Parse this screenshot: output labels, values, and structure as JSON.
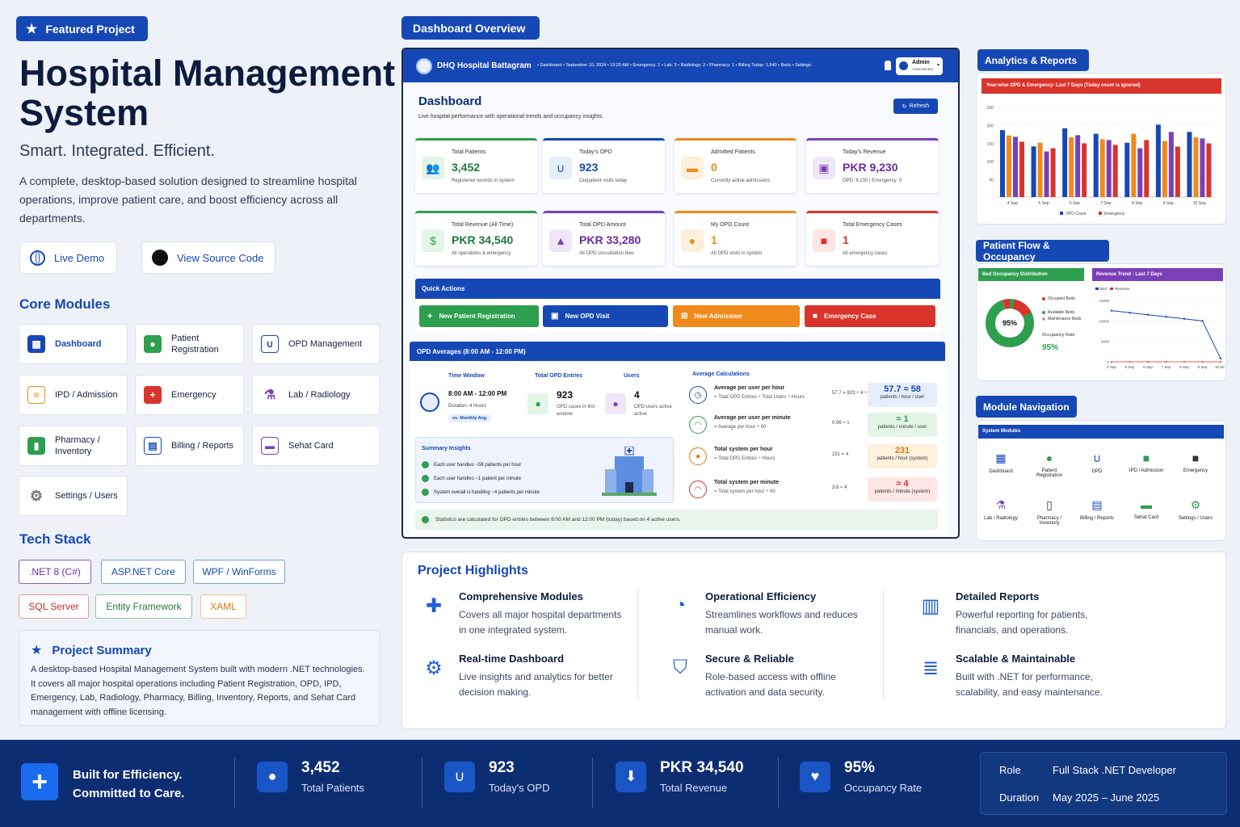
{
  "featured_label": "Featured Project",
  "title_line1": "Hospital Management",
  "title_line2": "System",
  "tagline": "Smart. Integrated. Efficient.",
  "description": "A complete, desktop-based solution designed to streamline hospital operations, improve patient care, and boost efficiency across all departments.",
  "live_demo": "Live Demo",
  "view_source": "View Source Code",
  "core_modules_heading": "Core Modules",
  "modules": [
    "Dashboard",
    "Patient Registration",
    "OPD Management",
    "IPD / Admission",
    "Emergency",
    "Lab / Radiology",
    "Pharmacy / Inventory",
    "Billing / Reports",
    "Sehat Card",
    "Settings / Users"
  ],
  "tech_heading": "Tech Stack",
  "tech": [
    ".NET 8 (C#)",
    "ASP.NET Core",
    "WPF / WinForms",
    "SQL Server",
    "Entity Framework",
    "XAML"
  ],
  "summary_heading": "Project Summary",
  "summary_text": "A desktop-based Hospital Management System built with modern .NET technologies. It covers all major hospital operations including Patient Registration, OPD, IPD, Emergency, Lab, Radiology, Pharmacy, Billing, Inventory, Reports, and Sehat Card management with offline licensing.",
  "overview_label": "Dashboard Overview",
  "app": {
    "hospital": "DHQ Hospital Battagram",
    "topbar": "• Dashboard  • September 10, 2024  • 10:20 AM  • Emergency: 1  • Lab: 3  • Radiology: 2  • Pharmacy: 1  • Billing  Today: 1,540  • Beds  • Settings",
    "user": "Admin",
    "user_role": "Administrator",
    "dash_title": "Dashboard",
    "dash_sub": "Live hospital performance with operational trends and occupancy insights.",
    "refresh": "Refresh",
    "stats": [
      {
        "label": "Total Patients",
        "value": "3,452",
        "sub": "Registered records in system",
        "color": "#2e9e4f"
      },
      {
        "label": "Today's OPD",
        "value": "923",
        "sub": "Outpatient visits today",
        "color": "#1648b5"
      },
      {
        "label": "Admitted Patients",
        "value": "0",
        "sub": "Currently active admissions",
        "color": "#f08a1c"
      },
      {
        "label": "Today's Revenue",
        "value": "PKR 9,230",
        "sub": "OPD: 9,230 | Emergency: 0",
        "color": "#7b3fb8"
      },
      {
        "label": "Total Revenue (All Time)",
        "value": "PKR 34,540",
        "sub": "All operations & emergency",
        "color": "#2e9e4f"
      },
      {
        "label": "Total OPD Amount",
        "value": "PKR 33,280",
        "sub": "All OPD consultation fees",
        "color": "#7b3fb8"
      },
      {
        "label": "My OPD Count",
        "value": "1",
        "sub": "All OPD visits in system",
        "color": "#f08a1c"
      },
      {
        "label": "Total Emergency Cases",
        "value": "1",
        "sub": "All emergency cases",
        "color": "#d9342b"
      }
    ],
    "quick_actions_title": "Quick Actions",
    "quick_actions": [
      "New Patient Registration",
      "New OPD Visit",
      "New Admission",
      "Emergency Case"
    ],
    "opd_title": "OPD Averages (8:00 AM - 12:00 PM)",
    "time_window_label": "Time Window",
    "time_window": "8:00 AM - 12:00 PM",
    "duration": "Duration: 4 Hours",
    "vs_monthly": "vs. Monthly Avg.",
    "opd_entries_label": "Total OPD Entries",
    "opd_entries": "923",
    "opd_entries_sub": "OPD cases in this window",
    "users_label": "Users",
    "users": "4",
    "users_sub": "OPD users active active",
    "avg_calc_label": "Average Calculations",
    "avg_rows": [
      {
        "title": "Average per user per hour",
        "sub": "= Total OPD Entries ÷ Total Users ÷ Hours",
        "eq": "57.7 = 923 ÷ 4 ÷ 4",
        "value": "57.7 ≈ 58",
        "unit": "patients / hour / user",
        "color": "#1648b5",
        "bg": "#e6eefc"
      },
      {
        "title": "Average per user per minute",
        "sub": "= Average per hour ÷ 60",
        "eq": "0.96 ≈ 1",
        "value": "≈ 1",
        "unit": "patients / minute / user",
        "color": "#2e9e4f",
        "bg": "#e4f5e8"
      },
      {
        "title": "Total system per hour",
        "sub": "= Total OPD Entries ÷ Hours",
        "eq": "231 = 4",
        "value": "231",
        "unit": "patients / hour (system)",
        "color": "#e07b0d",
        "bg": "#fdf0dd"
      },
      {
        "title": "Total system per minute",
        "sub": "= Total system per hour ÷ 60",
        "eq": "3.8 ≈ 4",
        "value": "≈ 4",
        "unit": "patients / minute (system)",
        "color": "#d9342b",
        "bg": "#fde6e4"
      }
    ],
    "insights_title": "Summary Insights",
    "insights": [
      "Each user handles ~58 patients per hour",
      "Each user handles ~1 patient per minute",
      "System overall is handling ~4 patients per minute"
    ],
    "footer_note": "Statistics are calculated for OPD entries between 8:00 AM and 12:00 PM (today) based on 4 active users."
  },
  "analytics": {
    "label": "Analytics & Reports",
    "chart_title": "Year-wise OPD & Emergency: Last 7 Days (Today count is ignored)",
    "legend": [
      "OPD Count",
      "Emergency"
    ]
  },
  "chart_data": {
    "type": "bar",
    "categories": [
      "4 Sep",
      "5 Sep",
      "6 Sep",
      "7 Sep",
      "8 Sep",
      "9 Sep",
      "10 Sep"
    ],
    "series": [
      {
        "name": "OPD Count",
        "values": [
          185,
          140,
          190,
          175,
          150,
          200,
          180
        ]
      },
      {
        "name": "Emergency",
        "values": [
          170,
          150,
          165,
          160,
          175,
          155,
          165
        ]
      }
    ],
    "ylim": [
      0,
      250
    ],
    "yticks": [
      "250",
      "200",
      "150",
      "100",
      "50"
    ]
  },
  "flow": {
    "label": "Patient Flow & Occupancy",
    "bed_title": "Bed Occupancy Distribution",
    "bed_pct": "95%",
    "occupancy_label": "Occupancy Rate",
    "bed_legend": [
      "Occupied Beds",
      "Available Beds",
      "Maintenance Beds"
    ],
    "revenue_title": "Revenue Trend - Last 7 Days",
    "revenue_legend": [
      "Bed",
      "Revenue"
    ],
    "revenue_yticks": [
      "15000",
      "10000",
      "5000",
      "0"
    ]
  },
  "revenue_trend": {
    "type": "line",
    "x": [
      "4 Sep",
      "5 Sep",
      "6 Sep",
      "7 Sep",
      "8 Sep",
      "9 Sep",
      "10 Sep"
    ],
    "values": [
      12500,
      12000,
      11500,
      11000,
      10500,
      10000,
      800
    ],
    "ylim": [
      0,
      15000
    ]
  },
  "bed_occupancy": {
    "type": "pie",
    "values": [
      95,
      5
    ],
    "labels": [
      "Occupied Beds",
      "Available Beds"
    ]
  },
  "nav": {
    "label": "Module Navigation",
    "header": "System Modules",
    "items": [
      "Dashboard",
      "Patient Registration",
      "OPD",
      "IPD / Admission",
      "Emergency",
      "Lab / Radiology",
      "Pharmacy / Inventory",
      "Billing / Reports",
      "Sehat Card",
      "Settings / Users"
    ]
  },
  "highlights_heading": "Project Highlights",
  "highlights": [
    {
      "title": "Comprehensive Modules",
      "desc": "Covers all major hospital departments in one integrated system."
    },
    {
      "title": "Operational Efficiency",
      "desc": "Streamlines workflows and reduces manual work."
    },
    {
      "title": "Detailed Reports",
      "desc": "Powerful reporting for patients, financials, and operations."
    },
    {
      "title": "Real-time Dashboard",
      "desc": "Live insights and analytics for better decision making."
    },
    {
      "title": "Secure & Reliable",
      "desc": "Role-based access with offline activation and data security."
    },
    {
      "title": "Scalable & Maintainable",
      "desc": "Built with .NET for performance, scalability, and easy maintenance."
    }
  ],
  "footer": {
    "motto1": "Built for Efficiency.",
    "motto2": "Committed to Care.",
    "stats": [
      {
        "value": "3,452",
        "label": "Total Patients"
      },
      {
        "value": "923",
        "label": "Today's OPD"
      },
      {
        "value": "PKR 34,540",
        "label": "Total Revenue"
      },
      {
        "value": "95%",
        "label": "Occupancy Rate"
      }
    ],
    "role_label": "Role",
    "role": "Full Stack .NET Developer",
    "duration_label": "Duration",
    "duration": "May 2025 – June 2025"
  },
  "colors": {
    "primary": "#1648b5",
    "green": "#2e9e4f",
    "orange": "#f08a1c",
    "red": "#d9342b",
    "purple": "#7b3fb8",
    "footer": "#0d2d73"
  }
}
